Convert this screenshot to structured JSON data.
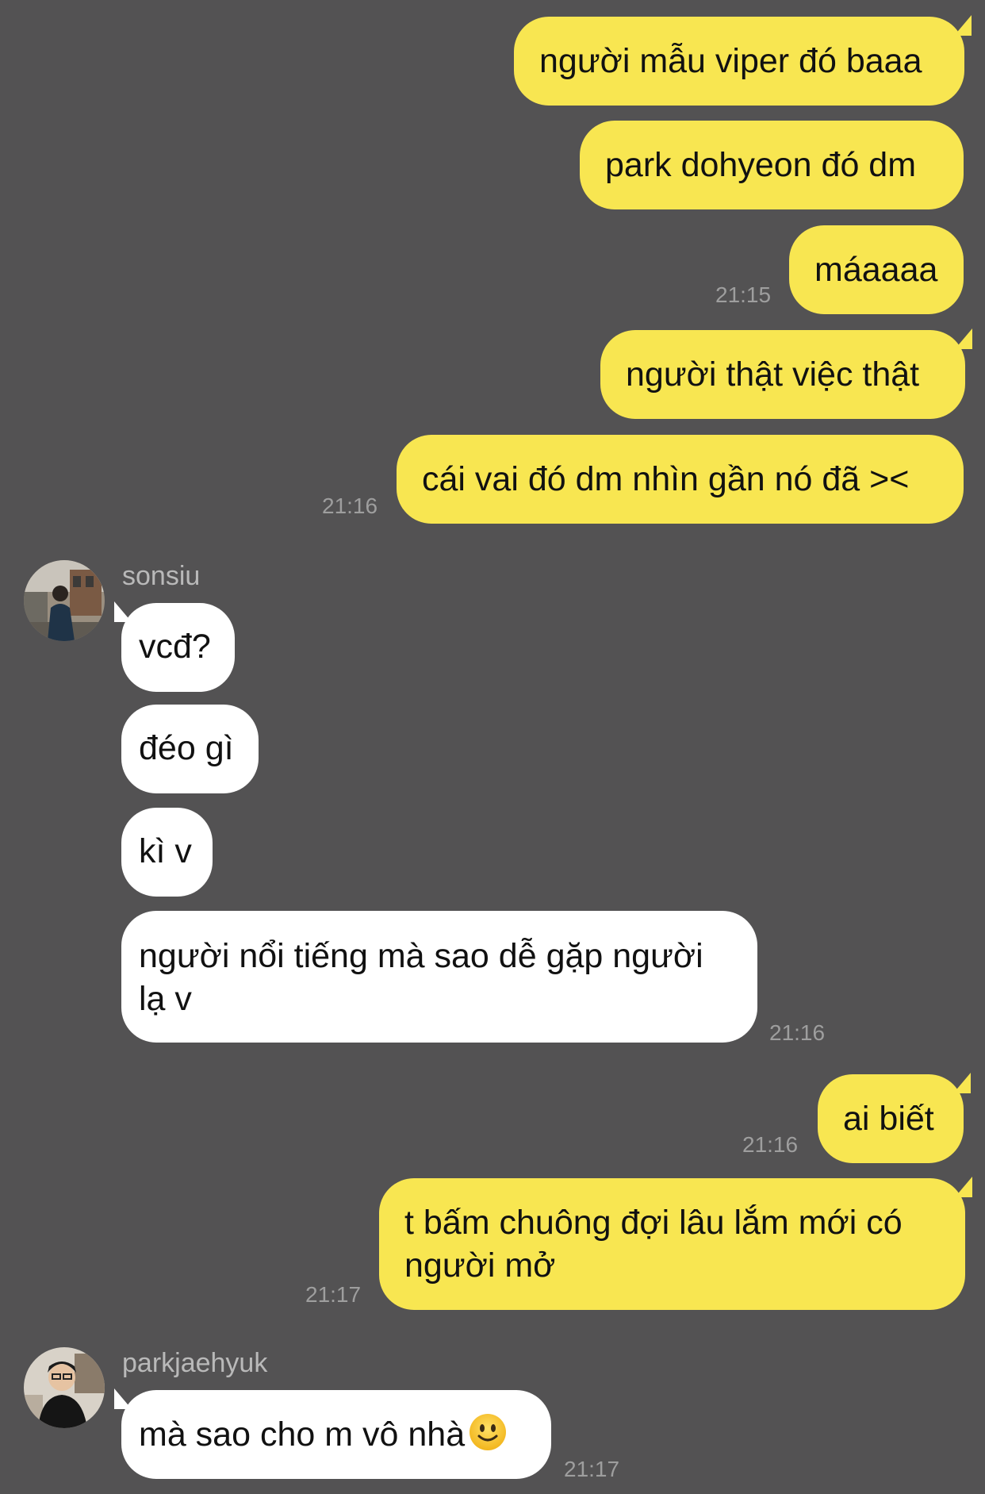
{
  "outgoing_group_1": [
    "người mẫu viper đó baaa",
    "park dohyeon đó dm",
    "máaaaa",
    "người thật việc thật",
    "cái vai đó dm nhìn gần nó đã ><"
  ],
  "outgoing_group_1_times": [
    "21:15",
    "21:16"
  ],
  "contact_1": {
    "name": "sonsiu",
    "avatar_icon": "user-avatar-photo",
    "messages": [
      "vcđ?",
      "đéo gì",
      "kì v",
      "người nổi tiếng mà sao dễ gặp người lạ v"
    ],
    "time": "21:16"
  },
  "outgoing_group_2": [
    "ai biết",
    "t bấm chuông đợi lâu lắm mới có người mở"
  ],
  "outgoing_group_2_times": [
    "21:16",
    "21:17"
  ],
  "contact_2": {
    "name": "parkjaehyuk",
    "avatar_icon": "user-avatar-photo",
    "messages": [
      "mà sao cho m vô nhà"
    ],
    "emoji": "slightly-smiling-face-icon",
    "time": "21:17"
  },
  "colors": {
    "background": "#535253",
    "outgoing_bubble": "#F8E651",
    "incoming_bubble": "#FFFFFF",
    "timestamp": "#9E9E9E",
    "sender_name": "#B9B9B9"
  }
}
